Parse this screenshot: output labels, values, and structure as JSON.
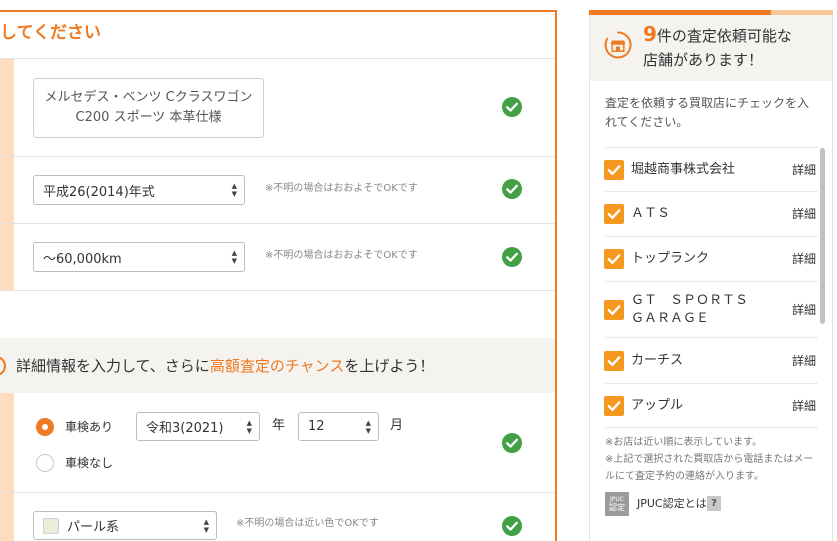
{
  "colors": {
    "accent": "#ee7a22",
    "peach_strip": "#fddcc0",
    "check_green": "#43a047",
    "checkbox_orange": "#f5981f",
    "section_bg": "#f5f3ef",
    "bar_light": "#f7c896"
  },
  "icons": {
    "field_ok": "check-circle-icon",
    "select": "select-arrows-icon",
    "store": "store-icon",
    "store_checkbox": "checkbox-checked-icon",
    "jpuc": "jpuc-badge-icon",
    "help": "help-icon"
  },
  "form": {
    "header_title": "してください",
    "car_name": {
      "line1": "メルセデス・ベンツ Cクラスワゴン",
      "line2": "C200 スポーツ 本革仕様"
    },
    "model_year": {
      "value": "平成26(2014)年式",
      "note": "※不明の場合はおおよそでOKです"
    },
    "mileage": {
      "value": "～60,000km",
      "note": "※不明の場合はおおよそでOKです"
    },
    "detail_section": {
      "prefix": "詳細情報を入力して、さらに",
      "highlight": "高額査定のチャンス",
      "suffix": "を上げよう！"
    },
    "inspection": {
      "option_yes": "車検あり",
      "option_yes_checked": true,
      "option_no": "車検なし",
      "option_no_checked": false,
      "era_year_value": "令和3(2021)",
      "year_unit": "年",
      "month_value": "12",
      "month_unit": "月"
    },
    "body_color": {
      "value": "パール系",
      "swatch": "#ecedd8",
      "note": "※不明の場合は近い色でOKです"
    }
  },
  "sidebar": {
    "count": "9",
    "title_suffix": "件の査定依頼可能な",
    "title_line2": "店舗があります！",
    "instruction_lines": [
      "査定を依頼する買取店にチェックを入",
      "れてください。"
    ],
    "detail_label": "詳細",
    "stores": [
      {
        "name": "堀越商事株式会社",
        "checked": true
      },
      {
        "name": "ＡＴＳ",
        "checked": true
      },
      {
        "name": "トップランク",
        "checked": true
      },
      {
        "name": "ＧＴ　ＳＰＯＲＴＳ",
        "name_line2": "ＧＡＲＡＧＥ",
        "checked": true
      },
      {
        "name": "カーチス",
        "checked": true
      },
      {
        "name": "アップル",
        "checked": true
      }
    ],
    "notes": [
      "※お店は近い順に表示しています。",
      "※上記で選択された買取店から電話またはメー",
      "ルにて査定予約の連絡が入ります。"
    ],
    "jpuc": {
      "badge_top": "JPUC",
      "badge_bottom": "認定",
      "link_text": "JPUC認定とは",
      "help": "?"
    }
  }
}
